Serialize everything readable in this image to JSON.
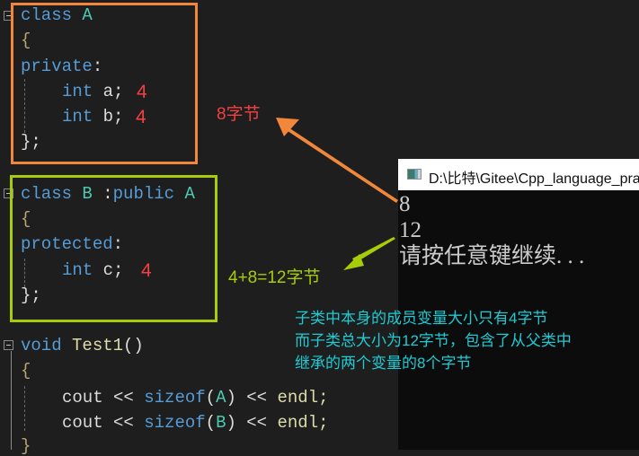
{
  "editor": {
    "class_a": {
      "header_kw": "class",
      "header_name": "A",
      "open_brace": "{",
      "access": "private",
      "colon": ":",
      "members": [
        {
          "type": "int",
          "decl": "a;",
          "size_note": "4"
        },
        {
          "type": "int",
          "decl": "b;",
          "size_note": "4"
        }
      ],
      "close": "};"
    },
    "class_b": {
      "header_kw": "class",
      "header_name": "B",
      "inherit_sep": ":",
      "inherit_kw": "public",
      "base_name": "A",
      "open_brace": "{",
      "access": "protected",
      "colon": ":",
      "members": [
        {
          "type": "int",
          "decl": "c;",
          "size_note": "4"
        }
      ],
      "close": "};"
    },
    "test_func": {
      "ret_kw": "void",
      "name": "Test1",
      "parens": "()",
      "open_brace": "{",
      "statements": [
        {
          "stream": "cout",
          "op": "<<",
          "func": "sizeof",
          "arg": "A",
          "op2": "<<",
          "end": "endl;"
        },
        {
          "stream": "cout",
          "op": "<<",
          "func": "sizeof",
          "arg": "B",
          "op2": "<<",
          "end": "endl;"
        }
      ],
      "close": "}"
    }
  },
  "annotations": {
    "class_a_size": "8字节",
    "class_b_size": "4+8=12字节",
    "explanation": [
      "子类中本身的成员变量大小只有4字节",
      "而子类总大小为12字节，包含了从父类中",
      "继承的两个变量的8个字节"
    ],
    "colors": {
      "class_a_box": "#f0873a",
      "class_b_box": "#a6cc0a",
      "size_red": "#f44040",
      "explanation": "#1ecbd3"
    }
  },
  "console": {
    "title": "D:\\比特\\Gitee\\Cpp_language_pra",
    "output": [
      "8",
      "12",
      "请按任意键继续. . ."
    ]
  }
}
